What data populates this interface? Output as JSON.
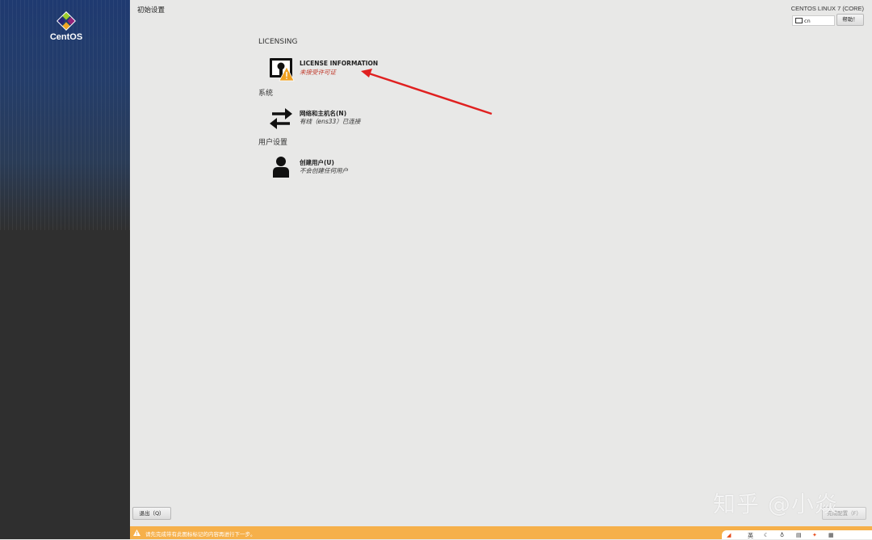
{
  "sidebar": {
    "logo_text": "CentOS"
  },
  "header": {
    "title": "初始设置",
    "distro": "CENTOS LINUX 7 (CORE)",
    "keyboard_layout": "cn",
    "help_label": "帮助！"
  },
  "sections": {
    "licensing": "LICENSING",
    "system": "系统",
    "user": "用户设置"
  },
  "spokes": {
    "license": {
      "title": "LICENSE INFORMATION",
      "status": "未接受许可证",
      "icon": "license-warning-icon"
    },
    "network": {
      "title": "网络和主机名(N)",
      "status": "有线（ens33）已连接",
      "icon": "network-arrows-icon"
    },
    "user": {
      "title": "创建用户(U)",
      "status": "不会创建任何用户",
      "icon": "user-icon"
    }
  },
  "footer": {
    "quit_label": "退出（Q）",
    "finish_label": "完成配置（F）",
    "warning_text": "请先完成带有此图标标记的内容再进行下一步。"
  },
  "watermark": "知乎 @小焱",
  "colors": {
    "warning_bar": "#f6b04a",
    "warning_text": "#c0392b",
    "annotation_arrow": "#e02020"
  }
}
